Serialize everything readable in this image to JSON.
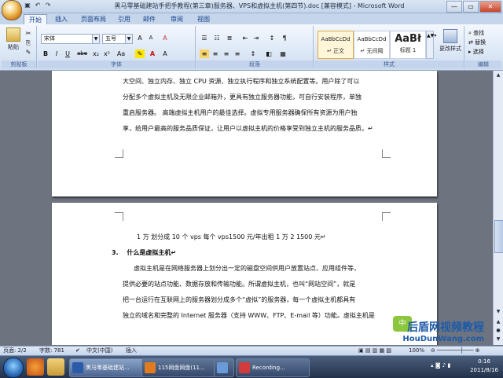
{
  "window": {
    "title": "黑马零基础建站手把手教程(第三章)服务器、VPS和虚拟主机(第四节).doc [兼容模式] - Microsoft Word",
    "min": "—",
    "max": "▭",
    "close": "✕"
  },
  "tabs": [
    "开始",
    "插入",
    "页面布局",
    "引用",
    "邮件",
    "审阅",
    "视图"
  ],
  "ribbon": {
    "paste_label": "粘贴",
    "clipboard_label": "剪贴板",
    "font_name": "宋体",
    "font_size": "五号",
    "font_group_label": "字体",
    "paragraph_label": "段落",
    "styles_label": "样式",
    "editing_label": "编辑",
    "styles": [
      {
        "sample": "AaBbCcDd",
        "name": "↵ 正文"
      },
      {
        "sample": "AaBbCcDd",
        "name": "↵ 无间隔"
      },
      {
        "sample": "AaBł",
        "name": "标题 1"
      }
    ],
    "change_styles": "更改样式",
    "find": "查找",
    "replace": "替换",
    "select": "选择",
    "format_buttons": [
      "B",
      "I",
      "U",
      "abe",
      "x₂",
      "x²",
      "Aa"
    ],
    "font_buttons": [
      "A",
      "A",
      "A"
    ]
  },
  "document": {
    "page1_lines": [
      "大空间、独立内存、独立 CPU 资源、独立执行程序和独立系统配置等。用户除了可以",
      "分配多个虚拟主机及无限企业邮箱外，更具有独立服务器功能，可自行安装程序，单独",
      "重启服务器。 高端虚拟主机用户的最佳选择。虚拟专用服务器确保所有资源为用户独",
      "享，给用户最高的服务品质保证，让用户以虚拟主机的价格享受到独立主机的服务品质。↵"
    ],
    "page2_note": "1 万  划分成 10 个 vps   每个 vps1500 元/年出租    1 万 2    1500 元↵",
    "heading_number": "3.",
    "heading": "什么是虚拟主机↵",
    "page2_lines": [
      "虚拟主机是在网络服务器上划分出一定的磁盘空间供用户放置站点、应用组件等，",
      "提供必要的站点功能、数据存放和传输功能。所谓虚拟主机，也叫“网站空间”，就是",
      "把一台运行在互联网上的服务器划分成多个“虚拟”的服务器，每一个虚拟主机都具有",
      "独立的域名和完整的 Internet 服务器（支持 WWW、FTP、E-mail 等）功能。虚拟主机是"
    ]
  },
  "watermark": {
    "logo": "中",
    "cn": "后盾网视频教程",
    "url": "HouDunWang.com"
  },
  "statusbar": {
    "page": "页面: 2/2",
    "words": "字数: 781",
    "language": "中文(中国)",
    "mode": "插入",
    "zoom": "100%"
  },
  "taskbar": {
    "tasks": [
      "黑马零基础建站...",
      "115网盘网盘(11...",
      "",
      "Recording..."
    ],
    "time": "0:16",
    "date": "2011/8/16"
  }
}
